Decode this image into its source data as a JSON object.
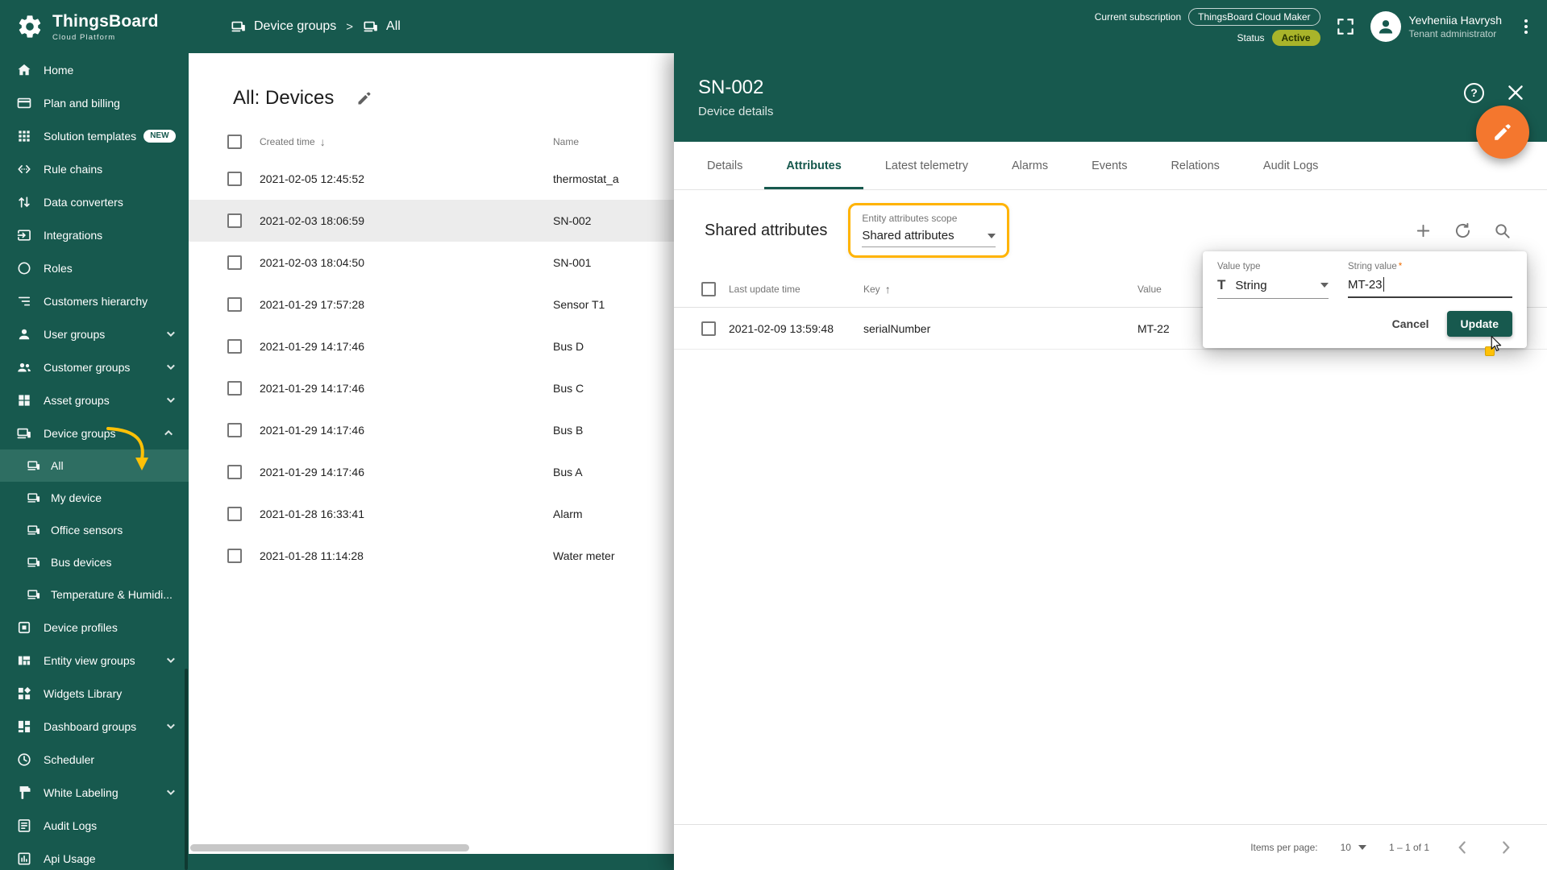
{
  "colors": {
    "primary_green": "#17594E",
    "sidebar_selected": "#2E6E62",
    "accent_orange": "#F4772E",
    "highlight_amber": "#FFB300",
    "active_chip": "#A9B42A"
  },
  "icons": {
    "breadcrumb_separator": ">",
    "sort_desc": "↓",
    "sort_asc": "↑",
    "help_glyph": "?"
  },
  "topbar": {
    "logo_title": "ThingsBoard",
    "logo_subtitle": "Cloud Platform",
    "breadcrumb": [
      {
        "label": "Device groups"
      },
      {
        "label": "All"
      }
    ],
    "subscription_label": "Current subscription",
    "subscription_value": "ThingsBoard Cloud Maker",
    "status_label": "Status",
    "status_value": "Active",
    "user_name": "Yevheniia Havrysh",
    "user_role": "Tenant administrator"
  },
  "sidebar": {
    "items": [
      {
        "label": "Home"
      },
      {
        "label": "Plan and billing"
      },
      {
        "label": "Solution templates",
        "badge": "NEW"
      },
      {
        "label": "Rule chains"
      },
      {
        "label": "Data converters"
      },
      {
        "label": "Integrations"
      },
      {
        "label": "Roles"
      },
      {
        "label": "Customers hierarchy"
      },
      {
        "label": "User groups"
      },
      {
        "label": "Customer groups"
      },
      {
        "label": "Asset groups"
      },
      {
        "label": "Device groups"
      },
      {
        "label": "Device profiles"
      },
      {
        "label": "Entity view groups"
      },
      {
        "label": "Widgets Library"
      },
      {
        "label": "Dashboard groups"
      },
      {
        "label": "Scheduler"
      },
      {
        "label": "White Labeling"
      },
      {
        "label": "Audit Logs"
      },
      {
        "label": "Api Usage"
      }
    ],
    "device_groups_children": [
      {
        "label": "All"
      },
      {
        "label": "My device"
      },
      {
        "label": "Office sensors"
      },
      {
        "label": "Bus devices"
      },
      {
        "label": "Temperature & Humidi..."
      }
    ]
  },
  "devices_panel": {
    "title": "All: Devices",
    "columns": {
      "created_time": "Created time",
      "name": "Name"
    },
    "rows": [
      {
        "created_time": "2021-02-05 12:45:52",
        "name": "thermostat_a"
      },
      {
        "created_time": "2021-02-03 18:06:59",
        "name": "SN-002"
      },
      {
        "created_time": "2021-02-03 18:04:50",
        "name": "SN-001"
      },
      {
        "created_time": "2021-01-29 17:57:28",
        "name": "Sensor T1"
      },
      {
        "created_time": "2021-01-29 14:17:46",
        "name": "Bus D"
      },
      {
        "created_time": "2021-01-29 14:17:46",
        "name": "Bus C"
      },
      {
        "created_time": "2021-01-29 14:17:46",
        "name": "Bus B"
      },
      {
        "created_time": "2021-01-29 14:17:46",
        "name": "Bus A"
      },
      {
        "created_time": "2021-01-28 16:33:41",
        "name": "Alarm"
      },
      {
        "created_time": "2021-01-28 11:14:28",
        "name": "Water meter"
      }
    ]
  },
  "drawer": {
    "title": "SN-002",
    "subtitle": "Device details",
    "tabs": [
      {
        "label": "Details"
      },
      {
        "label": "Attributes"
      },
      {
        "label": "Latest telemetry"
      },
      {
        "label": "Alarms"
      },
      {
        "label": "Events"
      },
      {
        "label": "Relations"
      },
      {
        "label": "Audit Logs"
      }
    ],
    "attributes": {
      "section_title": "Shared attributes",
      "scope_label": "Entity attributes scope",
      "scope_value": "Shared attributes",
      "columns": {
        "last_update_time": "Last update time",
        "key": "Key",
        "value": "Value"
      },
      "rows": [
        {
          "last_update_time": "2021-02-09 13:59:48",
          "key": "serialNumber",
          "value": "MT-22"
        }
      ]
    },
    "edit_popup": {
      "value_type_label": "Value type",
      "value_type_value": "String",
      "string_value_label": "String value",
      "required_asterisk": "*",
      "string_value": "MT-23",
      "cancel_label": "Cancel",
      "update_label": "Update"
    },
    "pagination": {
      "items_per_page_label": "Items per page:",
      "items_per_page_value": "10",
      "range_label": "1 – 1 of 1"
    }
  }
}
